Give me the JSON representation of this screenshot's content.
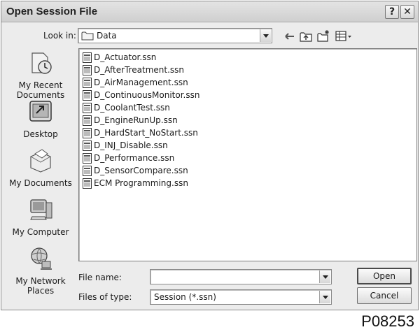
{
  "window": {
    "title": "Open Session File",
    "help_label": "?",
    "close_label": "✕"
  },
  "lookin": {
    "label": "Look in:",
    "value": "Data"
  },
  "places": [
    {
      "label": "My Recent Documents",
      "icon": "recent-documents-icon"
    },
    {
      "label": "Desktop",
      "icon": "desktop-icon"
    },
    {
      "label": "My Documents",
      "icon": "my-documents-icon"
    },
    {
      "label": "My Computer",
      "icon": "my-computer-icon"
    },
    {
      "label": "My Network Places",
      "icon": "network-places-icon"
    }
  ],
  "files": [
    "D_Actuator.ssn",
    "D_AfterTreatment.ssn",
    "D_AirManagement.ssn",
    "D_ContinuousMonitor.ssn",
    "D_CoolantTest.ssn",
    "D_EngineRunUp.ssn",
    "D_HardStart_NoStart.ssn",
    "D_INJ_Disable.ssn",
    "D_Performance.ssn",
    "D_SensorCompare.ssn",
    "ECM Programming.ssn"
  ],
  "filename": {
    "label": "File name:",
    "value": ""
  },
  "filetype": {
    "label": "Files of type:",
    "value": "Session (*.ssn)"
  },
  "buttons": {
    "open": "Open",
    "cancel": "Cancel"
  },
  "figure_code": "P08253"
}
